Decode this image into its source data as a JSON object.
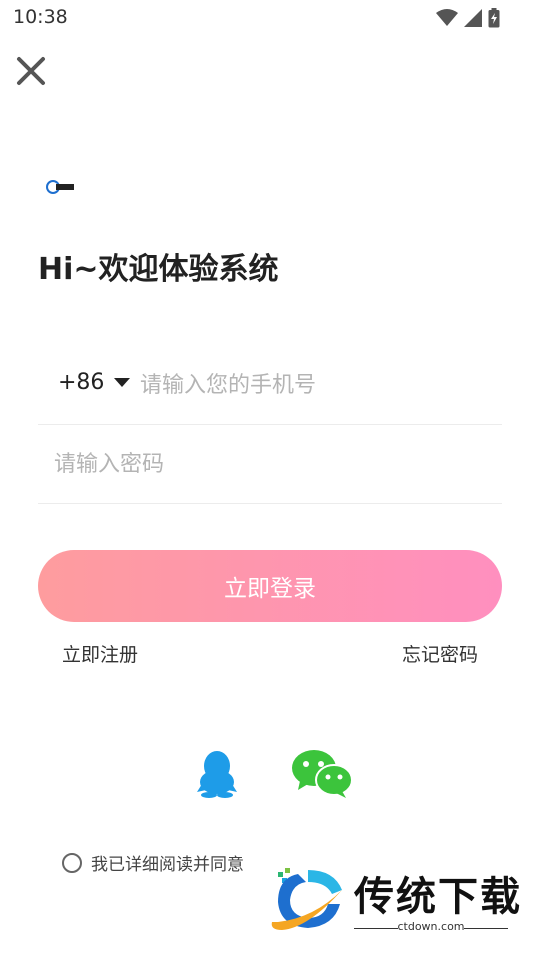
{
  "status_bar": {
    "time": "10:38",
    "icons": [
      "wifi-icon",
      "signal-icon",
      "battery-icon"
    ]
  },
  "close_icon": "close-icon",
  "logo": {
    "icon": "app-logo",
    "text": "传统下载"
  },
  "welcome": {
    "title": "Hi~欢迎体验系统"
  },
  "phone": {
    "country_code": "+86",
    "placeholder": "请输入您的手机号",
    "value": ""
  },
  "password": {
    "placeholder": "请输入密码",
    "value": ""
  },
  "login": {
    "label": "立即登录"
  },
  "links": {
    "register": "立即注册",
    "forgot": "忘记密码"
  },
  "social": {
    "qq_icon": "qq-icon",
    "wechat_icon": "wechat-icon"
  },
  "agreement": {
    "text": "我已详细阅读并同意",
    "checked": false
  },
  "watermark": {
    "title": "传统下载",
    "url": "ctdown.com"
  },
  "colors": {
    "accent_start": "#fe9c9e",
    "accent_end": "#ff8fbf",
    "qq_blue": "#1e9ce8",
    "wechat_green": "#3cc43c"
  }
}
